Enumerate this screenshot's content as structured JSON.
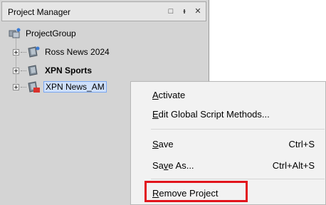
{
  "panel": {
    "title": "Project Manager",
    "buttons": {
      "restore": "□",
      "pin": "ᵻ",
      "close": "✕"
    }
  },
  "tree": {
    "root": {
      "label": "ProjectGroup",
      "icon": "project-group-icon"
    },
    "items": [
      {
        "label": "Ross News 2024",
        "bold": false,
        "selected": false,
        "icon": "project-icon"
      },
      {
        "label": "XPN Sports",
        "bold": true,
        "selected": false,
        "icon": "project-icon"
      },
      {
        "label": "XPN News_AM",
        "bold": false,
        "selected": true,
        "icon": "project-ps-icon"
      }
    ]
  },
  "menu": {
    "activate": {
      "pre": "",
      "acc": "A",
      "post": "ctivate"
    },
    "edit_global": {
      "pre": "",
      "acc": "E",
      "post": "dit Global Script Methods..."
    },
    "save": {
      "pre": "",
      "acc": "S",
      "post": "ave",
      "shortcut": "Ctrl+S"
    },
    "save_as": {
      "pre": "Sa",
      "acc": "v",
      "post": "e As...",
      "shortcut": "Ctrl+Alt+S"
    },
    "remove": {
      "pre": "",
      "acc": "R",
      "post": "emove Project"
    }
  },
  "colors": {
    "highlight_box": "#e2141c",
    "selection": "#cfe0fb"
  }
}
